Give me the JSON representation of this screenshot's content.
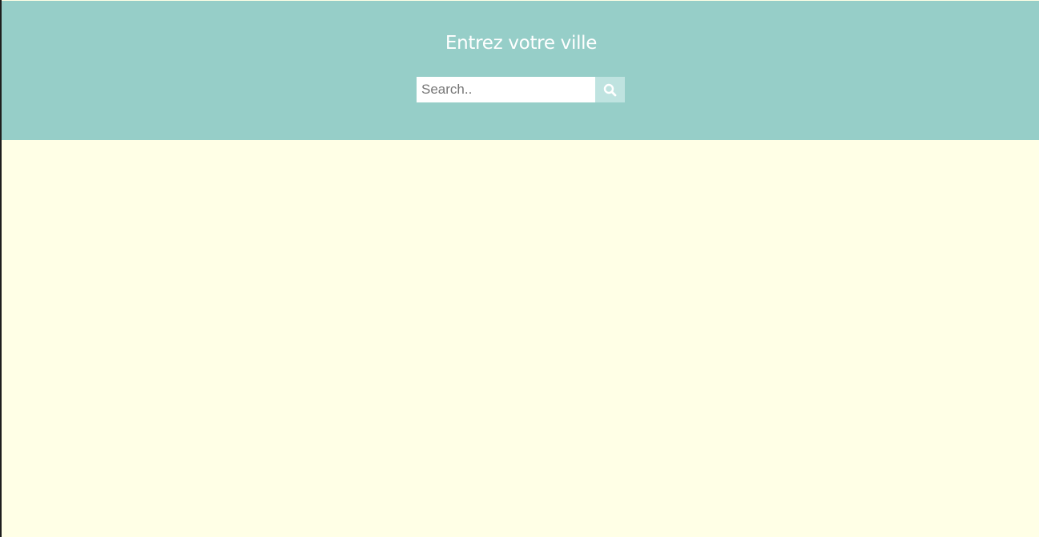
{
  "header": {
    "title": "Entrez votre ville"
  },
  "search": {
    "placeholder": "Search..",
    "value": "",
    "button_icon": "search-icon"
  },
  "colors": {
    "header_bg": "#96cec8",
    "page_bg": "#ffffe6",
    "search_button_bg": "#bfe3e0",
    "title_text": "#ffffff"
  }
}
